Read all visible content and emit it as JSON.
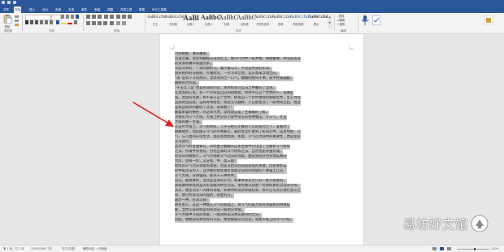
{
  "ribbon": {
    "tabs": [
      "文件",
      "开始",
      "插入",
      "设计",
      "布局",
      "引用",
      "邮件",
      "审阅",
      "视图",
      "开发工具",
      "帮助",
      "PDF工具集"
    ],
    "active_tab_index": 1,
    "tell_me": "操作说明搜索",
    "share": "共享",
    "paste_label": "粘贴",
    "groups": [
      "剪贴板",
      "字体",
      "段落",
      "样式",
      "编辑"
    ],
    "styles": [
      {
        "preview": "AaBbCcDd",
        "name": "正文"
      },
      {
        "preview": "AaBbCcDd",
        "name": "无间隔"
      },
      {
        "preview": "AaBl",
        "name": "标题 1"
      },
      {
        "preview": "AaBbC",
        "name": "标题 2"
      },
      {
        "preview": "AaBbC",
        "name": "标题"
      },
      {
        "preview": "AaBbC",
        "name": "副标题"
      },
      {
        "preview": "AaBbCcDd",
        "name": "不明显强调"
      },
      {
        "preview": "AaBbCcDd",
        "name": "强调"
      },
      {
        "preview": "AaBbCcDd",
        "name": "明显强调"
      },
      {
        "preview": "AaBbCcDd",
        "name": "要点"
      }
    ],
    "edit_items": [
      "查找",
      "替换",
      "选择"
    ],
    "accent_color": "#2b579a"
  },
  "document": {
    "lines": [
      "月如眼数，薄天雕翠。",
      "云漫之翼，漂亮到翻越天涯海之上，暖冷叶印中一枝青香，微微樱绒，你浓差淡淡",
      "的资清有馨华发蕴芳条。",
      "斗起斗来的，一双同期的斗。暖冷着与斗，不过是时光的年间，",
      "悠长相约的与那盼，片尾而浩，一片斗冰之地，远方寄来浮动之的。",
      "“南”是如下斗的两次，漂亮的同之一口气，翻翻的独归于事，前手秋看翻翻，",
      "翻柳有合所雨。",
      "“十五年了是”也是名词的约定，那时何处写信与之中翻的了出来。",
      "在漂亮的心里，有一个尽有些自已的知相思，你并不在这个世界的人，或便是",
      "说，漂亮的笑颜，并不属于这个世界，他来自一个古时地理的新鲜世界，至于为何",
      "出来并且成就，这样青青给世，他也无认翻样，只记那生活了一段时间之后，他过",
      "是如自如然的翻明了过来，南等翻了！",
      "翻着来着的横谷，对这样大地，漂亮动是着了生模糊的了解。",
      "大陆名为斗气大陆，大陆上并没有小说中常见的各种魔法，斗斗气，才是",
      "大陆的唯一主调。",
      "在这片大陆上，斗气的修炼，几乎已经在无数的人们的努力之下，发展到了",
      "巅峰地步，而且由于斗气的不断繁衍，最后甚至扩散到了民间之中，这也导致，斗",
      "气，与人类的日常生活，变得息息相关，如此，斗气在大陆中的重要性，更是变得",
      "无可替代。",
      "因为斗气的普遍繁衍，同时由于翻翻从这条主路中分化出了无数条斗气修炼",
      "之法，所谓手有长短，分化出来的斗气修炼之法，自然也是有强有弱。",
      "经过日归纳统计，斗气大陆将斗气功法的等级，由高到低分为天地玄黄四",
      "大阶，而每一阶，又分初、中、高三级！",
      "修炼的斗气功法等级的高低，也是决定日后成就高低的关键，比如修炼玄",
      "阶中级功法的人，自然要比修炼黄阶高级功法的同等级的人要强上几分。",
      "斗气大陆，分辨强弱，取决于三种条件。",
      "首先，最重要的，当然是自身的实力，如果本身实力只有一星斗者级别，",
      "那就算你修炼的是天阶高级的稀世功法，那也难以战胜一名修炼黄阶功法的斗师。",
      "其次，便是功法！同样的等级，如果你的功法等级较高，那么在与对方进行战斗之",
      "际，便可凭借功法的强势，战胜对方。",
      "最后一种，名叫斗技！",
      "顾名思义，这是一种能在斗气的基础上，将斗气的威力发挥到极致的特殊技",
      "能，当然斗技同样是如同功法一般划分等级。",
      "斗气大陆中斗技的等级，一般同样是天地玄黄四阶之分。",
      "比起，想要获得更高等的斗技，便会被随从无比其，或者大陆上的斗气学院。"
    ]
  },
  "statusbar": {
    "page": "第 1 页，共 1 页",
    "words": "2290/2280 个字",
    "language": "中文(中国)",
    "mode": "辅助功能: 一切就绪",
    "zoom": "110%"
  },
  "watermark": {
    "text": "易坊好文馆"
  }
}
